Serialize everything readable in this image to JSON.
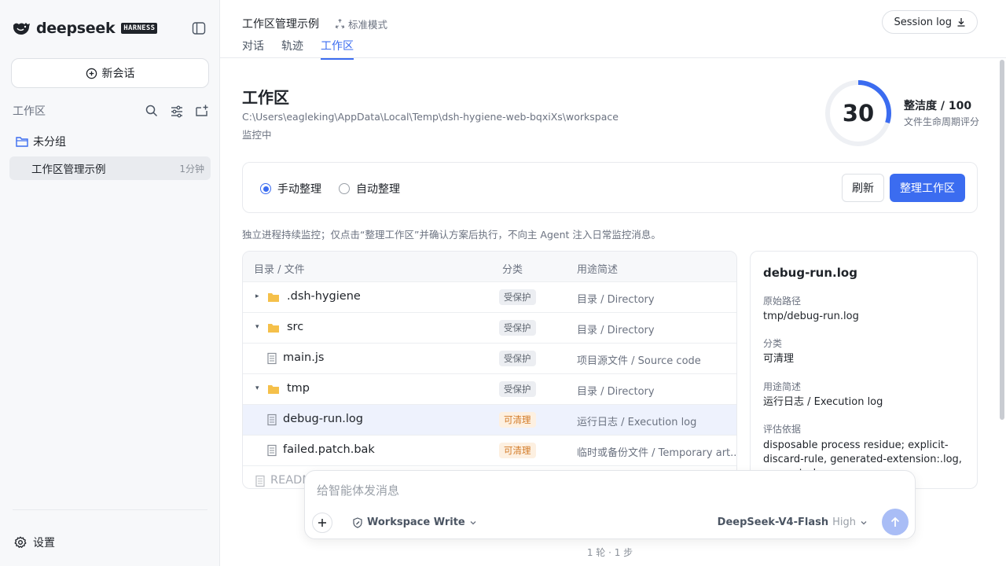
{
  "sidebar": {
    "brand_name": "deepseek",
    "brand_badge": "HARNESS",
    "new_chat_label": "新会话",
    "workspace_section_label": "工作区",
    "group_label": "未分组",
    "session": {
      "title": "工作区管理示例",
      "time": "1分钟"
    },
    "settings_label": "设置"
  },
  "header": {
    "title": "工作区管理示例",
    "mode": "标准模式",
    "tabs": [
      {
        "label": "对话",
        "active": false
      },
      {
        "label": "轨迹",
        "active": false
      },
      {
        "label": "工作区",
        "active": true
      }
    ],
    "session_log_label": "Session log"
  },
  "workspace": {
    "title": "工作区",
    "path": "C:\\Users\\eagleking\\AppData\\Local\\Temp\\dsh-hygiene-web-bqxiXs\\workspace",
    "status": "监控中",
    "score": {
      "value": "30",
      "max": 100,
      "percent": 30,
      "label": "整洁度 / 100",
      "sublabel": "文件生命周期评分",
      "ring_color": "#3b6cf0",
      "track_color": "#eef0f4"
    },
    "modes": [
      {
        "label": "手动整理",
        "checked": true
      },
      {
        "label": "自动整理",
        "checked": false
      }
    ],
    "refresh_label": "刷新",
    "clean_label": "整理工作区",
    "note": "独立进程持续监控；仅点击“整理工作区”并确认方案后执行，不向主 Agent 注入日常监控消息。",
    "table": {
      "columns": [
        "目录 / 文件",
        "分类",
        "用途简述"
      ],
      "rows": [
        {
          "name": ".dsh-hygiene",
          "type": "folder",
          "caret": "▸",
          "category": "受保护",
          "kind": "protected",
          "desc": "目录 / Directory"
        },
        {
          "name": "src",
          "type": "folder",
          "caret": "▾",
          "category": "受保护",
          "kind": "protected",
          "desc": "目录 / Directory"
        },
        {
          "name": "main.js",
          "type": "file",
          "caret": "",
          "category": "受保护",
          "kind": "protected",
          "desc": "项目源文件 / Source code"
        },
        {
          "name": "tmp",
          "type": "folder",
          "caret": "▾",
          "category": "受保护",
          "kind": "protected",
          "desc": "目录 / Directory"
        },
        {
          "name": "debug-run.log",
          "type": "file",
          "caret": "",
          "category": "可清理",
          "kind": "cleanable",
          "desc": "运行日志 / Execution log"
        },
        {
          "name": "failed.patch.bak",
          "type": "file",
          "caret": "",
          "category": "可清理",
          "kind": "cleanable",
          "desc": "临时或备份文件 / Temporary art..."
        },
        {
          "name": "READM",
          "type": "file",
          "caret": "",
          "category": "",
          "kind": "",
          "desc": ""
        }
      ]
    },
    "detail": {
      "title": "debug-run.log",
      "path_label": "原始路径",
      "path": "tmp/debug-run.log",
      "category_label": "分类",
      "category": "可清理",
      "purpose_label": "用途简述",
      "purpose": "运行日志 / Execution log",
      "basis_label": "评估依据",
      "basis": "disposable process residue; explicit-discard-rule, generated-extension:.log, generated-"
    }
  },
  "composer": {
    "placeholder": "给智能体发消息",
    "permission": "Workspace Write",
    "model": "DeepSeek-V4-Flash",
    "level": "High",
    "stats": "1 轮 · 1 步"
  }
}
